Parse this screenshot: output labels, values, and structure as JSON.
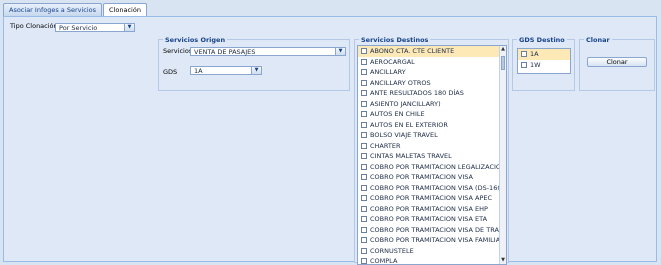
{
  "tabs": [
    {
      "label": "Asociar Infoges a Servicios",
      "active": false
    },
    {
      "label": "Clonación",
      "active": true
    }
  ],
  "tipo_clonacion": {
    "label": "Tipo Clonación",
    "value": "Por Servicio"
  },
  "servicios_origen": {
    "legend": "Servicios Origen",
    "servicios_label": "Servicios",
    "servicios_value": "VENTA DE PASAJES",
    "gds_label": "GDS",
    "gds_value": "1A"
  },
  "servicios_destinos": {
    "legend": "Servicios Destinos",
    "items": [
      "ABONO CTA. CTE CLIENTE",
      "AEROCARGAL",
      "ANCILLARY",
      "ANCILLARY OTROS",
      "ANTE RESULTADOS 180 DÍAS",
      "ASIENTO JANCILLARY)",
      "AUTOS EN CHILE",
      "AUTOS EN EL EXTERIOR",
      "BOLSO VIAJE TRAVEL",
      "CHARTER",
      "CINTAS MALETAS TRAVEL",
      "COBRO POR TRAMITACION LEGALIZACION D",
      "COBRO POR TRAMITACION VISA",
      "COBRO POR TRAMITACION VISA (DS-160)",
      "COBRO POR TRAMITACION VISA APEC",
      "COBRO POR TRAMITACION VISA EHP",
      "COBRO POR TRAMITACION VISA ETA",
      "COBRO POR TRAMITACION VISA DE TRABAJO",
      "COBRO POR TRAMITACION VISA FAMILIAR",
      "CORNUSTELE",
      "COMPLA"
    ]
  },
  "gds_destino": {
    "legend": "GDS Destino",
    "items": [
      "1A",
      "1W"
    ]
  },
  "clonar": {
    "legend": "Clonar",
    "button_label": "Clonar"
  },
  "arrow_glyph": "▼",
  "scroll_up_glyph": "▲",
  "scroll_down_glyph": "▼"
}
